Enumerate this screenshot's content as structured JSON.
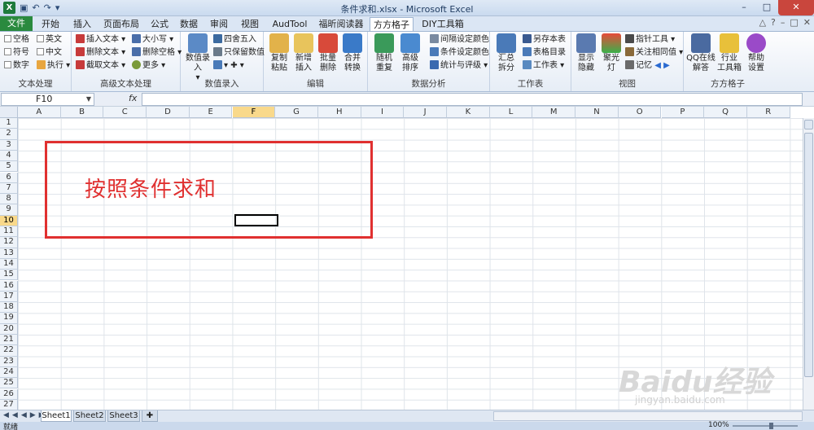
{
  "window": {
    "title": "条件求和.xlsx - Microsoft Excel",
    "app_icon": "X",
    "qat": [
      "save-icon",
      "undo-icon",
      "redo-icon",
      "customize-icon"
    ],
    "controls": {
      "minimize": "–",
      "maximize": "□",
      "close": "✕"
    }
  },
  "tabs": [
    "文件",
    "开始",
    "插入",
    "页面布局",
    "公式",
    "数据",
    "审阅",
    "视图",
    "AudTool",
    "福昕阅读器",
    "方方格子",
    "DIY工具箱"
  ],
  "active_tab": "方方格子",
  "ribbon": {
    "groups": [
      {
        "label": "文本处理",
        "items": [
          "空格",
          "英文",
          "符号",
          "中文",
          "数字",
          "执行"
        ]
      },
      {
        "label": "高级文本处理",
        "items": [
          "插入文本",
          "大小写",
          "删除文本",
          "删除空格",
          "截取文本",
          "更多"
        ]
      },
      {
        "label": "数值录入",
        "items": [
          "数值录入",
          "四舍五入",
          "只保留数值"
        ],
        "big": "数值\n录入"
      },
      {
        "label": "编辑",
        "big": [
          "复制\n粘贴",
          "新增\n插入",
          "批量\n删除",
          "合并\n转换"
        ]
      },
      {
        "label": "数据分析",
        "big": [
          "随机\n重复",
          "高级\n排序"
        ],
        "items": [
          "间隔设定颜色",
          "条件设定颜色",
          "统计与评级"
        ]
      },
      {
        "label": "工作表",
        "big": [
          "汇总\n拆分"
        ],
        "items": [
          "另存本表",
          "表格目录",
          "工作表"
        ]
      },
      {
        "label": "视图",
        "big": [
          "显示\n隐藏",
          "聚光\n灯"
        ],
        "items": [
          "指针工具",
          "关注相同值",
          "记忆"
        ]
      },
      {
        "label": "方方格子",
        "big": [
          "QQ在线\n解答",
          "行业\n工具箱",
          "帮助\n设置"
        ]
      }
    ]
  },
  "formula_bar": {
    "name_box": "F10",
    "fx": "fx",
    "formula": ""
  },
  "columns": [
    "A",
    "B",
    "C",
    "D",
    "E",
    "F",
    "G",
    "H",
    "I",
    "J",
    "K",
    "L",
    "M",
    "N",
    "O",
    "P",
    "Q",
    "R"
  ],
  "selected_column": "F",
  "rows": [
    "1",
    "2",
    "3",
    "4",
    "5",
    "6",
    "7",
    "8",
    "9",
    "10",
    "11",
    "12",
    "13",
    "14",
    "15",
    "16",
    "17",
    "18",
    "19",
    "20",
    "21",
    "22",
    "23",
    "24",
    "25",
    "26",
    "27"
  ],
  "selected_row": "10",
  "annotation": {
    "text": "按照条件求和",
    "color": "#e03030"
  },
  "sheets": [
    "Sheet1",
    "Sheet2",
    "Sheet3"
  ],
  "active_sheet": "Sheet1",
  "status": {
    "ready": "就绪",
    "zoom": "100%"
  },
  "watermark": {
    "brand": "Baidu经验",
    "url": "jingyan.baidu.com"
  }
}
